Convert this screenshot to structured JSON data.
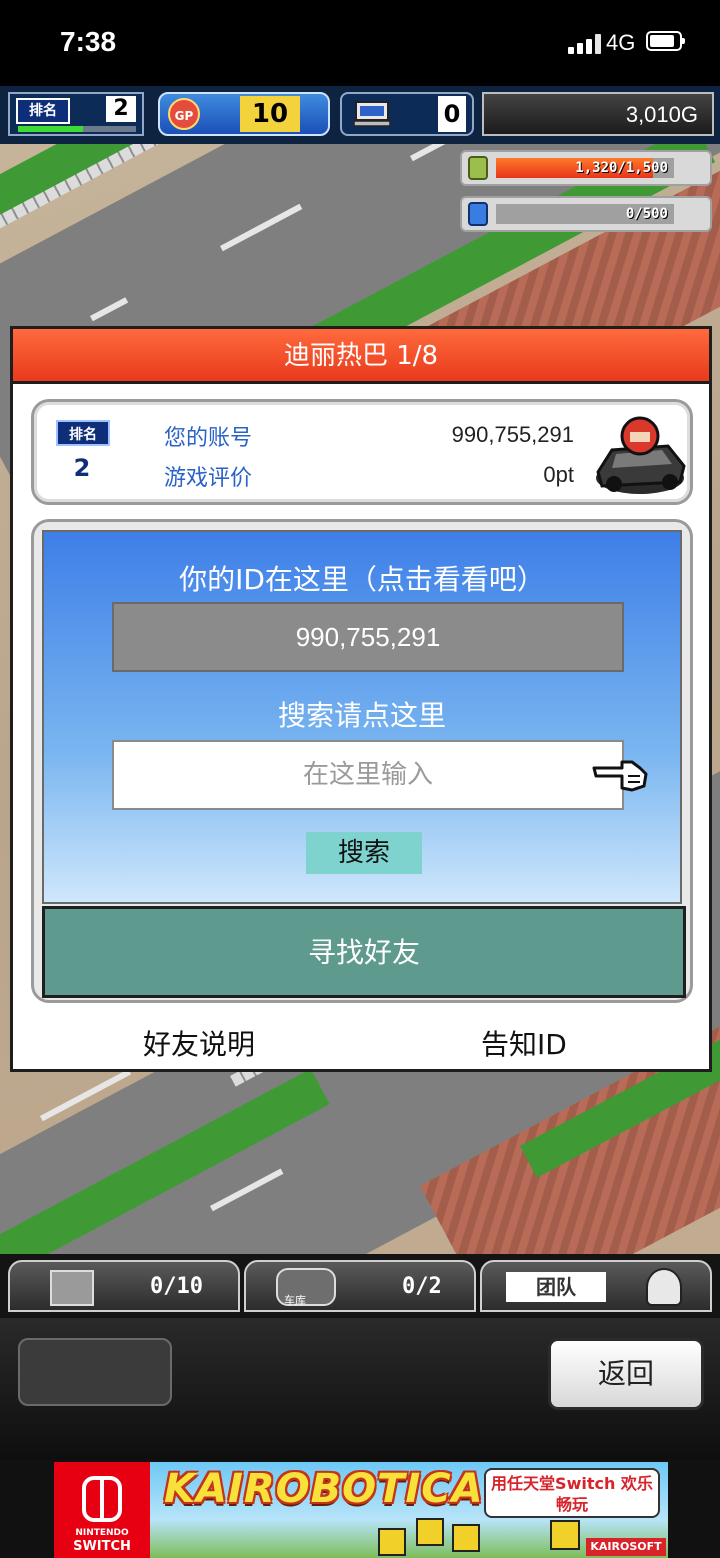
{
  "status_bar": {
    "time": "7:38",
    "network": "4G"
  },
  "hud": {
    "rank_label": "排名",
    "rank_value": "2",
    "rank_progress": 0.55,
    "gp_label": "GP",
    "gp_value": "10",
    "pc_value": "0",
    "money": "3,010G",
    "resource1": {
      "text": "1,320/1,500",
      "fill": 0.88
    },
    "resource2": {
      "text": "0/500",
      "fill": 0
    }
  },
  "dialog": {
    "title": "迪丽热巴 1/8",
    "profile": {
      "rank_label": "排名",
      "rank_value": "2",
      "account_label": "您的账号",
      "account_value": "990,755,291",
      "rating_label": "游戏评价",
      "rating_value": "0pt"
    },
    "id_heading": "你的ID在这里（点击看看吧）",
    "id_value": "990,755,291",
    "search_heading": "搜索请点这里",
    "search_placeholder": "在这里输入",
    "search_button": "搜索",
    "find_friend_button": "寻找好友",
    "friend_help_link": "好友说明",
    "tell_id_link": "告知ID"
  },
  "bottom_bar": {
    "items_count": "0/10",
    "garage_label": "车库",
    "garage_count": "0/2",
    "team_label": "团队",
    "back_button": "返回"
  },
  "ad": {
    "brand_line1": "NINTENDO",
    "brand_line2": "SWITCH",
    "title": "KAIROBOTICA",
    "slogan": "用任天堂Switch 欢乐畅玩",
    "maker": "KAIROSOFT"
  },
  "colors": {
    "dialog_title": "#e83a1c",
    "find_friend": "#5e9a8e",
    "search_button": "#7fd3cf",
    "blue_panel_top": "#3e7fe8"
  }
}
